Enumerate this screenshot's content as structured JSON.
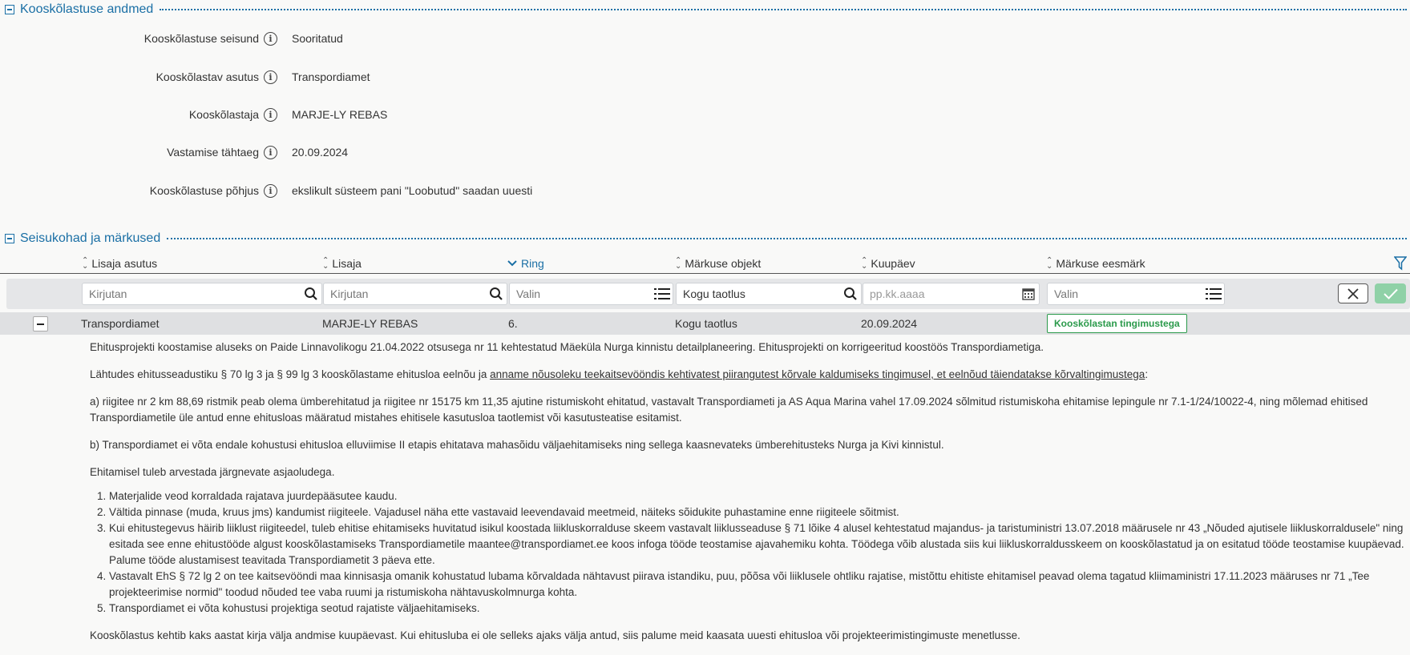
{
  "sections": {
    "approval_data": "Kooskõlastuse andmed",
    "positions": "Seisukohad ja märkused"
  },
  "fields": [
    {
      "label": "Kooskõlastuse seisund",
      "value": "Sooritatud"
    },
    {
      "label": "Kooskõlastav asutus",
      "value": "Transpordiamet"
    },
    {
      "label": "Kooskõlastaja",
      "value": "MARJE-LY REBAS"
    },
    {
      "label": "Vastamise tähtaeg",
      "value": "20.09.2024"
    },
    {
      "label": "Kooskõlastuse põhjus",
      "value": "ekslikult süsteem pani \"Loobutud\" saadan uuesti"
    }
  ],
  "info_glyph": "i",
  "table": {
    "columns": [
      "Lisaja asutus",
      "Lisaja",
      "Ring",
      "Märkuse objekt",
      "Kuupäev",
      "Märkuse eesmärk"
    ],
    "filters": {
      "f0": "Kirjutan",
      "f1": "Kirjutan",
      "f2": "Valin",
      "f3": "Kogu taotlus",
      "f4": "pp.kk.aaaa",
      "f5": "Valin"
    },
    "row": {
      "asutus": "Transpordiamet",
      "lisaja": "MARJE-LY REBAS",
      "ring": "6.",
      "objekt": "Kogu taotlus",
      "kuupaev": "20.09.2024",
      "eesmark": "Kooskõlastan tingimustega"
    }
  },
  "details": {
    "p1": "Ehitusprojekti koostamise aluseks on Paide Linnavolikogu 21.04.2022 otsusega nr 11 kehtestatud Mäeküla Nurga kinnistu detailplaneering. Ehitusprojekti on korrigeeritud koostöös Transpordiametiga.",
    "p2_start": "Lähtudes ehitusseadustiku § 70 lg 3 ja § 99 lg 3 kooskõlastame ehitusloa eelnõu ja ",
    "p2_underlined": "anname nõusoleku teekaitsevööndis kehtivatest piirangutest kõrvale kaldumiseks tingimusel, et eelnõud täiendatakse kõrvaltingimustega",
    "p2_end": ":",
    "p3": "a) riigitee nr 2 km 88,69 ristmik peab olema ümberehitatud ja riigitee nr 15175 km 11,35 ajutine ristumiskoht ehitatud, vastavalt Transpordiameti ja AS Aqua Marina vahel 17.09.2024 sõlmitud ristumiskoha ehitamise lepingule nr 7.1-1/24/10022-4, ning mõlemad ehitised Transpordiametile üle antud enne ehitusloas määratud mistahes ehitisele kasutusloa taotlemist või kasutusteatise esitamist.",
    "p4": "b) Transpordiamet ei võta endale kohustusi ehitusloa elluviimise II etapis ehitatava mahasõidu väljaehitamiseks ning sellega kaasnevateks ümberehitusteks Nurga ja Kivi kinnistul.",
    "p5": "Ehitamisel tuleb arvestada järgnevate asjaoludega.",
    "list": [
      "Materjalide veod korraldada rajatava juurdepääsutee kaudu.",
      "Vältida pinnase (muda, kruus jms) kandumist riigiteele. Vajadusel näha ette vastavaid leevendavaid meetmeid, näiteks sõidukite puhastamine enne riigiteele sõitmist.",
      "Kui ehitustegevus häirib liiklust riigiteedel, tuleb ehitise ehitamiseks huvitatud isikul koostada liikluskorralduse skeem vastavalt liiklusseaduse § 71 lõike 4 alusel kehtestatud majandus- ja taristuministri 13.07.2018 määrusele nr 43 „Nõuded ajutisele liikluskorraldusele\" ning esitada see enne ehitustööde algust kooskõlastamiseks Transpordiametile maantee@transpordiamet.ee koos infoga tööde teostamise ajavahemiku kohta. Töödega võib alustada siis kui liikluskorraldusskeem on kooskõlastatud ja on esitatud tööde teostamise kuupäevad. Palume tööde alustamisest teavitada Transpordiametit 3 päeva ette.",
      "Vastavalt EhS § 72 lg 2 on tee kaitsevööndi maa kinnisasja omanik kohustatud lubama kõrvaldada nähtavust piirava istandiku, puu, põõsa või liiklusele ohtliku rajatise, mistõttu ehitiste ehitamisel peavad olema tagatud kliimaministri 17.11.2023 määruses nr 71 „Tee projekteerimise normid\" toodud nõuded tee vaba ruumi ja ristumiskoha nähtavuskolmnurga kohta.",
      "Transpordiamet ei võta kohustusi projektiga seotud rajatiste väljaehitamiseks."
    ],
    "p6": "Kooskõlastus kehtib kaks aastat kirja välja andmise kuupäevast. Kui ehitusluba ei ole selleks ajaks välja antud, siis palume meid kaasata uuesti ehitusloa või projekteerimistingimuste menetlusse."
  }
}
